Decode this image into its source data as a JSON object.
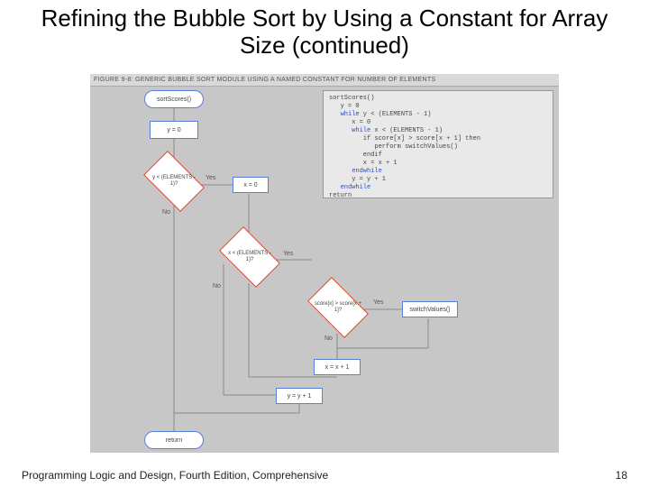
{
  "title": "Refining the Bubble Sort by Using a Constant for Array Size (continued)",
  "figure_caption": "FIGURE 9-8:  GENERIC BUBBLE SORT MODULE USING A NAMED CONSTANT FOR NUMBER OF ELEMENTS",
  "pseudocode": {
    "l1": "sortScores()",
    "l2": "   y = 0",
    "l3k": "   while",
    "l3r": " y < (ELEMENTS - 1)",
    "l4": "      x = 0",
    "l5k": "      while",
    "l5r": " x < (ELEMENTS - 1)",
    "l6": "         if score[x] > score[x + 1] then",
    "l7": "            perform switchValues()",
    "l8": "         endif",
    "l9": "         x = x + 1",
    "l10k": "      endwhile",
    "l11": "      y = y + 1",
    "l12k": "   endwhile",
    "l13": "return"
  },
  "nodes": {
    "start": "sortScores()",
    "y0": "y = 0",
    "cond1": "y < (ELEMENTS - 1)?",
    "x0": "x = 0",
    "cond2": "x < (ELEMENTS - 1)?",
    "cond3": "score[x] > score[x + 1]?",
    "swap": "switchValues()",
    "xinc": "x = x + 1",
    "yinc": "y = y + 1",
    "ret": "return"
  },
  "labels": {
    "yes": "Yes",
    "no": "No"
  },
  "footer": "Programming Logic and Design, Fourth Edition, Comprehensive",
  "pagenum": "18"
}
